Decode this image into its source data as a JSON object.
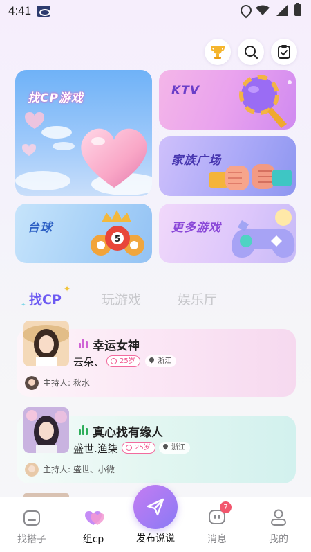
{
  "status_bar": {
    "time": "4:41"
  },
  "top_actions": [
    {
      "icon": "trophy-icon"
    },
    {
      "icon": "search-icon"
    },
    {
      "icon": "clipboard-icon"
    }
  ],
  "cards": {
    "cp": {
      "title": "找CP游戏"
    },
    "ktv": {
      "title": "KTV"
    },
    "family": {
      "title": "家族广场"
    },
    "pool": {
      "title": "台球"
    },
    "more": {
      "title": "更多游戏"
    }
  },
  "tabs": [
    {
      "label": "找CP",
      "active": true
    },
    {
      "label": "玩游戏",
      "active": false
    },
    {
      "label": "娱乐厅",
      "active": false
    }
  ],
  "rooms": [
    {
      "title": "幸运女神",
      "owner": "云朵、",
      "age": "25岁",
      "location": "浙江",
      "host_label": "主持人:",
      "host": "秋水",
      "eq_color": "#d064d6"
    },
    {
      "title": "真心找有缘人",
      "owner": "盛世.渔柒",
      "age": "25岁",
      "location": "浙江",
      "host_label": "主持人:",
      "host": "盛世、小微",
      "eq_color": "#2fae5b"
    }
  ],
  "nav": {
    "items": [
      {
        "label": "找搭子",
        "icon": "home-icon"
      },
      {
        "label": "组cp",
        "icon": "hearts-icon",
        "active": true
      },
      {
        "label": "消息",
        "icon": "message-icon",
        "badge": "7"
      },
      {
        "label": "我的",
        "icon": "profile-icon"
      }
    ],
    "publish_label": "发布说说"
  }
}
